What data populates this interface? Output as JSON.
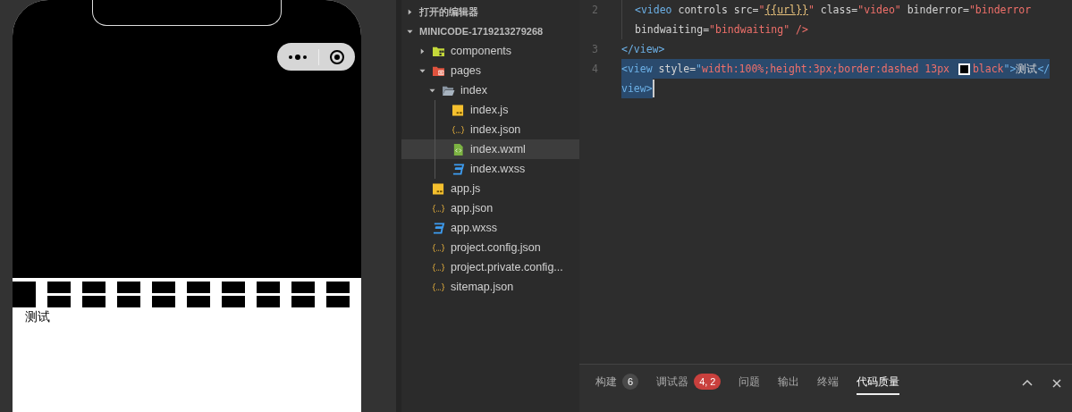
{
  "simulator": {
    "preview_text": "测试"
  },
  "explorer": {
    "sections": [
      {
        "label": "打开的编辑器",
        "expanded": false
      },
      {
        "label": "MINICODE-1719213279268",
        "expanded": true
      }
    ],
    "tree": [
      {
        "label": "components",
        "kind": "components",
        "expanded": false,
        "selected": false
      },
      {
        "label": "pages",
        "kind": "pages",
        "expanded": true,
        "selected": false,
        "children": [
          {
            "label": "index",
            "kind": "folder",
            "expanded": true,
            "selected": false,
            "children": [
              {
                "label": "index.js",
                "kind": "js",
                "selected": false
              },
              {
                "label": "index.json",
                "kind": "json",
                "selected": false
              },
              {
                "label": "index.wxml",
                "kind": "wxml",
                "selected": true
              },
              {
                "label": "index.wxss",
                "kind": "wxss",
                "selected": false
              }
            ]
          }
        ]
      },
      {
        "label": "app.js",
        "kind": "js",
        "selected": false
      },
      {
        "label": "app.json",
        "kind": "json",
        "selected": false
      },
      {
        "label": "app.wxss",
        "kind": "wxss",
        "selected": false
      },
      {
        "label": "project.config.json",
        "kind": "json",
        "selected": false
      },
      {
        "label": "project.private.config...",
        "kind": "json",
        "selected": false
      },
      {
        "label": "sitemap.json",
        "kind": "json",
        "selected": false
      }
    ]
  },
  "editor": {
    "lines": [
      {
        "number": "2",
        "selected": false,
        "rows": [
          [
            {
              "kind": "tag",
              "text": "<video "
            },
            {
              "kind": "attr",
              "text": "controls src="
            },
            {
              "kind": "str",
              "text": "\""
            },
            {
              "kind": "mustache",
              "text": "{{url}}"
            },
            {
              "kind": "str",
              "text": "\""
            },
            {
              "kind": "attr",
              "text": " class="
            },
            {
              "kind": "str",
              "text": "\"video\""
            },
            {
              "kind": "attr",
              "text": " binderror="
            },
            {
              "kind": "str",
              "text": "\"binderror"
            }
          ],
          [
            {
              "kind": "attr",
              "text": "bindwaiting="
            },
            {
              "kind": "str",
              "text": "\"bindwaiting\""
            },
            {
              "kind": "attr",
              "text": " "
            },
            {
              "kind": "close",
              "text": "/>"
            }
          ]
        ]
      },
      {
        "number": "3",
        "selected": false,
        "rows": [
          [
            {
              "kind": "tag",
              "text": "</view>"
            }
          ]
        ]
      },
      {
        "number": "4",
        "selected": true,
        "rows": [
          [
            {
              "kind": "tag",
              "text": "<view "
            },
            {
              "kind": "attr",
              "text": "style="
            },
            {
              "kind": "tag",
              "text": "\""
            },
            {
              "kind": "str",
              "text": "width:100%;height:3px;border:dashed 13px "
            },
            {
              "kind": "swatch",
              "color": "#000000"
            },
            {
              "kind": "str",
              "text": "black"
            },
            {
              "kind": "tag",
              "text": "\">"
            },
            {
              "kind": "attr",
              "text": "测试"
            },
            {
              "kind": "tag",
              "text": "</"
            }
          ],
          [
            {
              "kind": "tag",
              "text": "view>"
            }
          ]
        ]
      }
    ]
  },
  "panel": {
    "tabs": [
      {
        "label": "构建",
        "badge": {
          "text": "6",
          "color": "#4a4a4a"
        },
        "selected": false
      },
      {
        "label": "调试器",
        "badge": {
          "text": "4, 2",
          "color": "#c9403d"
        },
        "selected": false
      },
      {
        "label": "问题",
        "selected": false
      },
      {
        "label": "输出",
        "selected": false
      },
      {
        "label": "终端",
        "selected": false
      },
      {
        "label": "代码质量",
        "selected": true
      }
    ]
  }
}
